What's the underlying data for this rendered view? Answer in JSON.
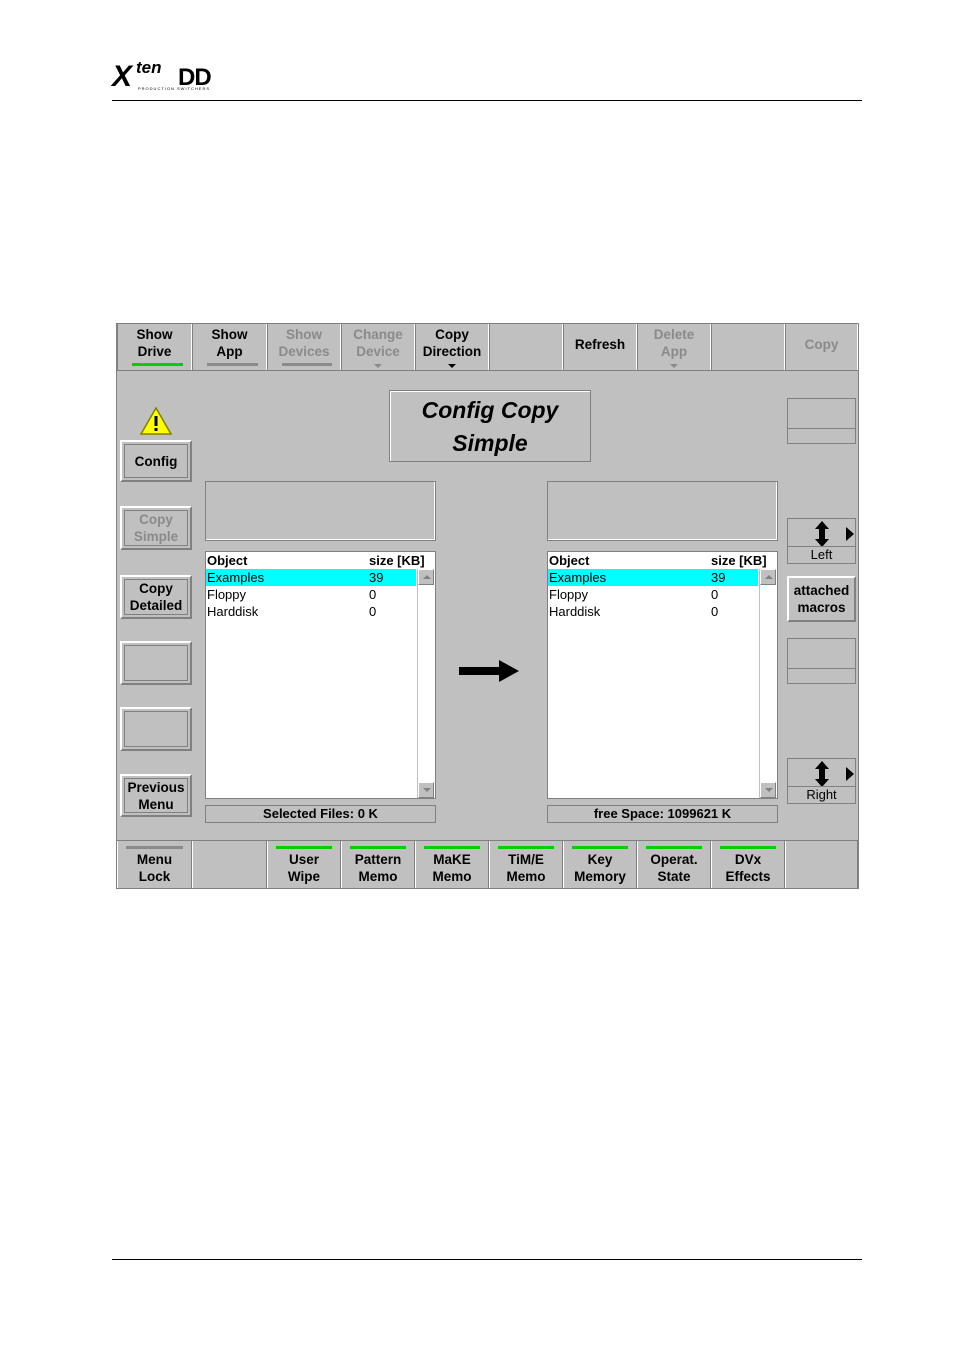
{
  "doc": {
    "logo_main": "Xten DD",
    "logo_sub": "PRODUCTION SWITCHERS"
  },
  "top_buttons": [
    {
      "label1": "Show",
      "label2": "Drive",
      "disabled": false,
      "bar": "green"
    },
    {
      "label1": "Show",
      "label2": "App",
      "disabled": false,
      "bar": "gray"
    },
    {
      "label1": "Show",
      "label2": "Devices",
      "disabled": true,
      "bar": "gray"
    },
    {
      "label1": "Change",
      "label2": "Device",
      "disabled": true,
      "dropdown": true
    },
    {
      "label1": "Copy",
      "label2": "Direction",
      "disabled": false,
      "dropdown": true
    },
    {
      "label1": "",
      "label2": ""
    },
    {
      "label1": "Refresh",
      "disabled": false
    },
    {
      "label1": "Delete",
      "label2": "App",
      "disabled": true,
      "dropdown": true
    },
    {
      "label1": "",
      "label2": ""
    },
    {
      "label1": "Copy",
      "disabled": true
    }
  ],
  "title": {
    "line1": "Config Copy",
    "line2": "Simple"
  },
  "side_buttons": {
    "config": "Config",
    "copy_simple_1": "Copy",
    "copy_simple_2": "Simple",
    "copy_detailed_1": "Copy",
    "copy_detailed_2": "Detailed",
    "previous_1": "Previous",
    "previous_2": "Menu"
  },
  "left_list": {
    "col_object": "Object",
    "col_size": "size [KB]",
    "rows": [
      {
        "name": "Examples",
        "size": "39"
      },
      {
        "name": "Floppy",
        "size": "0"
      },
      {
        "name": "Harddisk",
        "size": "0"
      }
    ],
    "status": "Selected Files:  0 K"
  },
  "right_list": {
    "col_object": "Object",
    "col_size": "size [KB]",
    "rows": [
      {
        "name": "Examples",
        "size": "39"
      },
      {
        "name": "Floppy",
        "size": "0"
      },
      {
        "name": "Harddisk",
        "size": "0"
      }
    ],
    "status": "free Space:  1099621 K"
  },
  "right_controls": {
    "left_label": "Left",
    "attached_1": "attached",
    "attached_2": "macros",
    "right_label": "Right"
  },
  "bottom_buttons": [
    {
      "label1": "Menu",
      "label2": "Lock"
    },
    {
      "label1": "",
      "label2": ""
    },
    {
      "label1": "User",
      "label2": "Wipe"
    },
    {
      "label1": "Pattern",
      "label2": "Memo"
    },
    {
      "label1": "MaKE",
      "label2": "Memo"
    },
    {
      "label1": "TiM/E",
      "label2": "Memo"
    },
    {
      "label1": "Key",
      "label2": "Memory"
    },
    {
      "label1": "Operat.",
      "label2": "State"
    },
    {
      "label1": "DVx",
      "label2": "Effects"
    },
    {
      "label1": "",
      "label2": ""
    }
  ],
  "colors": {
    "panel": "#c0c0c0",
    "selection": "#00ffff",
    "active_bar": "#00d000",
    "warning": "#ffff00"
  }
}
